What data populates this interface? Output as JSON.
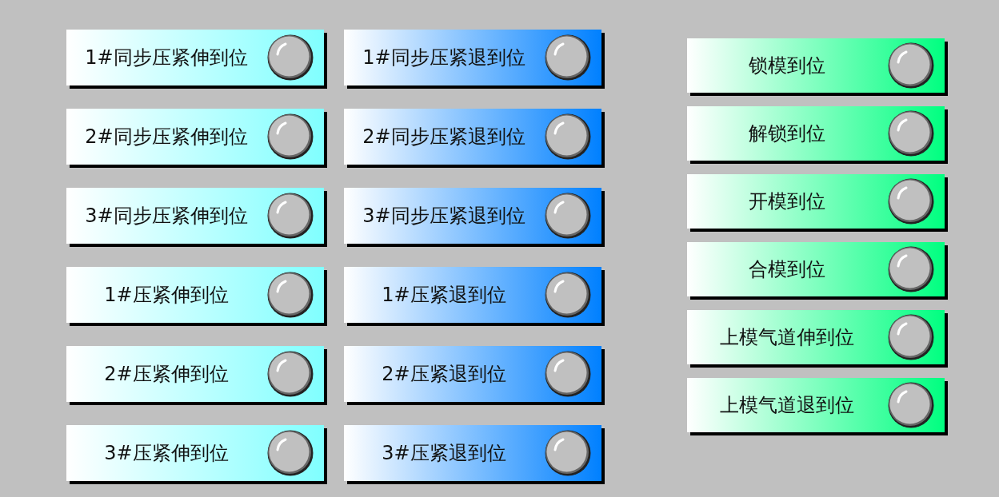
{
  "groups": [
    {
      "color": "#80ffff",
      "items": [
        {
          "label": "1#同步压紧伸到位",
          "on": false
        },
        {
          "label": "2#同步压紧伸到位",
          "on": false
        },
        {
          "label": "3#同步压紧伸到位",
          "on": false
        },
        {
          "label": "1#压紧伸到位",
          "on": false
        },
        {
          "label": "2#压紧伸到位",
          "on": false
        },
        {
          "label": "3#压紧伸到位",
          "on": false
        }
      ]
    },
    {
      "color": "#0080ff",
      "items": [
        {
          "label": "1#同步压紧退到位",
          "on": false
        },
        {
          "label": "2#同步压紧退到位",
          "on": false
        },
        {
          "label": "3#同步压紧退到位",
          "on": false
        },
        {
          "label": "1#压紧退到位",
          "on": false
        },
        {
          "label": "2#压紧退到位",
          "on": false
        },
        {
          "label": "3#压紧退到位",
          "on": false
        }
      ]
    },
    {
      "color": "#00ff80",
      "items": [
        {
          "label": "锁模到位",
          "on": false
        },
        {
          "label": "解锁到位",
          "on": false
        },
        {
          "label": "开模到位",
          "on": false
        },
        {
          "label": "合模到位",
          "on": false
        },
        {
          "label": "上模气道伸到位",
          "on": false
        },
        {
          "label": "上模气道退到位",
          "on": false
        }
      ]
    }
  ]
}
